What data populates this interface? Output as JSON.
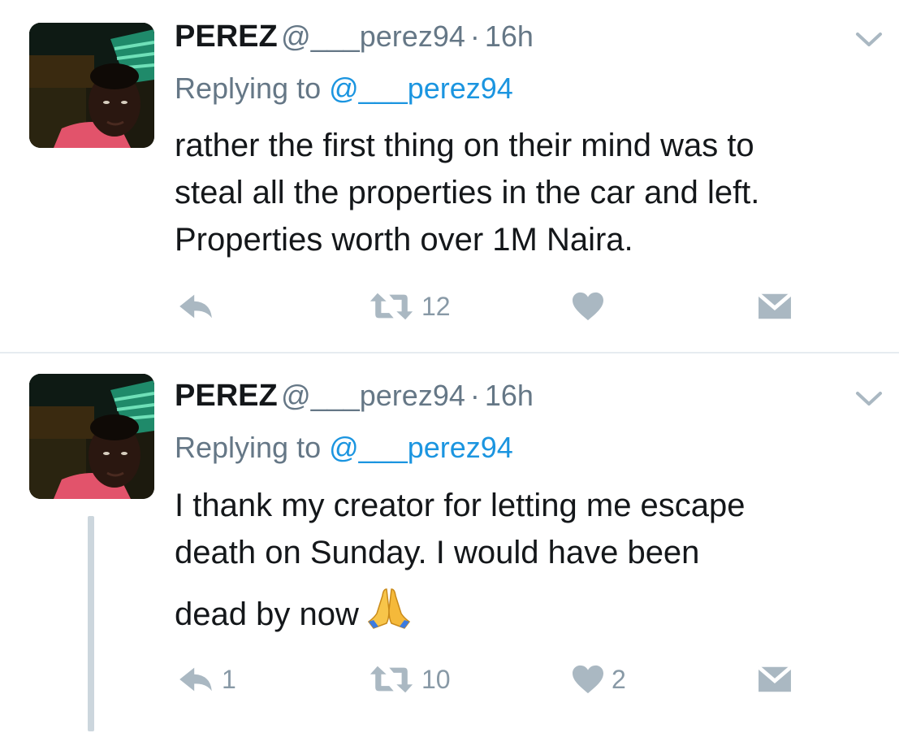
{
  "tweets": [
    {
      "author_name": "PEREZ",
      "handle": "@___perez94",
      "separator": "·",
      "time": "16h",
      "replying_label": "Replying to",
      "replying_handle": "@___perez94",
      "text_lines": [
        "rather the first thing on their mind was to",
        "steal all the properties in the car and left.",
        "Properties worth over 1M Naira."
      ],
      "reply_count": "",
      "retweet_count": "12",
      "like_count": ""
    },
    {
      "author_name": "PEREZ",
      "handle": "@___perez94",
      "separator": "·",
      "time": "16h",
      "replying_label": "Replying to",
      "replying_handle": "@___perez94",
      "text_lines": [
        "I thank my creator for letting me escape",
        "death on Sunday. I would have been",
        "dead by now"
      ],
      "emoji": "folded-hands",
      "reply_count": "1",
      "retweet_count": "10",
      "like_count": "2"
    }
  ],
  "icons": {
    "more": "chevron-down-icon",
    "reply": "reply-icon",
    "retweet": "retweet-icon",
    "like": "heart-icon",
    "message": "envelope-icon"
  },
  "colors": {
    "name": "#14171a",
    "secondary": "#657786",
    "link": "#1b95e0",
    "action_icon": "#aab8c2",
    "action_count": "#8899a6",
    "divider": "#e6ecf0",
    "thread_line": "#ccd6dd"
  }
}
